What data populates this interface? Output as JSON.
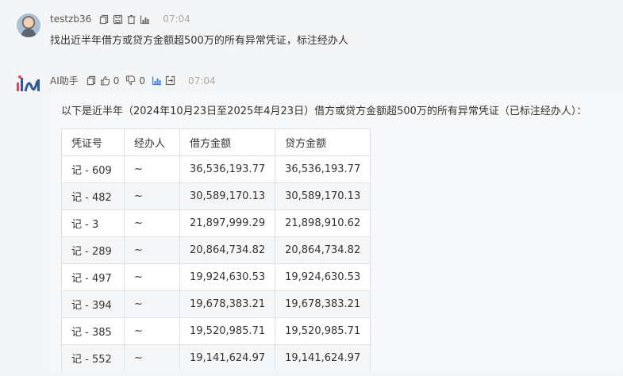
{
  "user_message": {
    "username": "testzb36",
    "time": "07:04",
    "text": "找出近半年借方或贷方金额超500万的所有异常凭证，标注经办人"
  },
  "ai_message": {
    "name": "AI助手",
    "like_count": "0",
    "dislike_count": "0",
    "time": "07:04",
    "intro": "以下是近半年（2024年10月23日至2025年4月23日）借方或贷方金额超500万的所有异常凭证（已标注经办人）：",
    "table": {
      "headers": [
        "凭证号",
        "经办人",
        "借方金额",
        "贷方金额"
      ],
      "rows": [
        [
          "记 - 609",
          "~",
          "36,536,193.77",
          "36,536,193.77"
        ],
        [
          "记 - 482",
          "~",
          "30,589,170.13",
          "30,589,170.13"
        ],
        [
          "记 - 3",
          "~",
          "21,897,999.29",
          "21,898,910.62"
        ],
        [
          "记 - 289",
          "~",
          "20,864,734.82",
          "20,864,734.82"
        ],
        [
          "记 - 497",
          "~",
          "19,924,630.53",
          "19,924,630.53"
        ],
        [
          "记 - 394",
          "~",
          "19,678,383.21",
          "19,678,383.21"
        ],
        [
          "记 - 385",
          "~",
          "19,520,985.71",
          "19,520,985.71"
        ],
        [
          "记 - 552",
          "~",
          "19,141,624.97",
          "19,141,624.97"
        ]
      ]
    }
  },
  "icons": {
    "user_actions": [
      "copy-icon",
      "save-icon",
      "delete-icon",
      "chart-icon"
    ],
    "ai_actions": [
      "copy-icon",
      "thumbs-up-icon",
      "thumbs-down-icon",
      "chart-icon",
      "export-icon"
    ]
  },
  "colors": {
    "accent": "#3b7de9",
    "background": "#f4f5f7"
  }
}
